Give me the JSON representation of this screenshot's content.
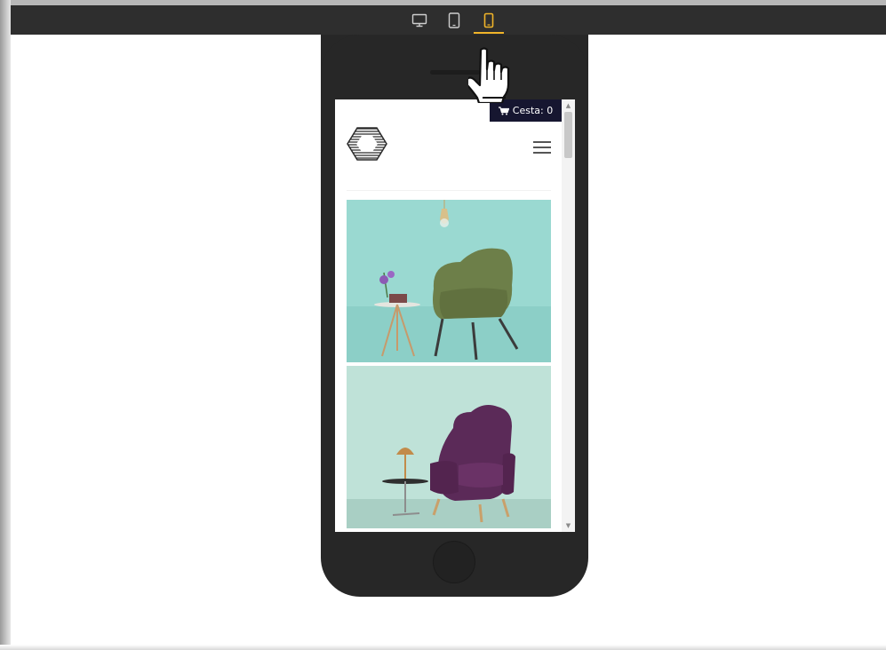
{
  "toolbar": {
    "devices": [
      {
        "icon": "desktop-icon",
        "active": false
      },
      {
        "icon": "tablet-icon",
        "active": false
      },
      {
        "icon": "mobile-icon",
        "active": true
      }
    ],
    "active_color": "#f0b429"
  },
  "site": {
    "cart": {
      "label": "Cesta: 0",
      "icon": "cart-icon"
    },
    "logo": "hexagon-logo",
    "menu_icon": "hamburger-menu-icon",
    "products": [
      {
        "name": "green-armchair-photo",
        "background": "#98d9d2"
      },
      {
        "name": "purple-wingback-armchair-photo",
        "background": "#b9ded4"
      }
    ]
  },
  "colors": {
    "toolbar_bg": "#2e2e2e",
    "phone_body": "#272727",
    "cart_bg": "#161630"
  }
}
